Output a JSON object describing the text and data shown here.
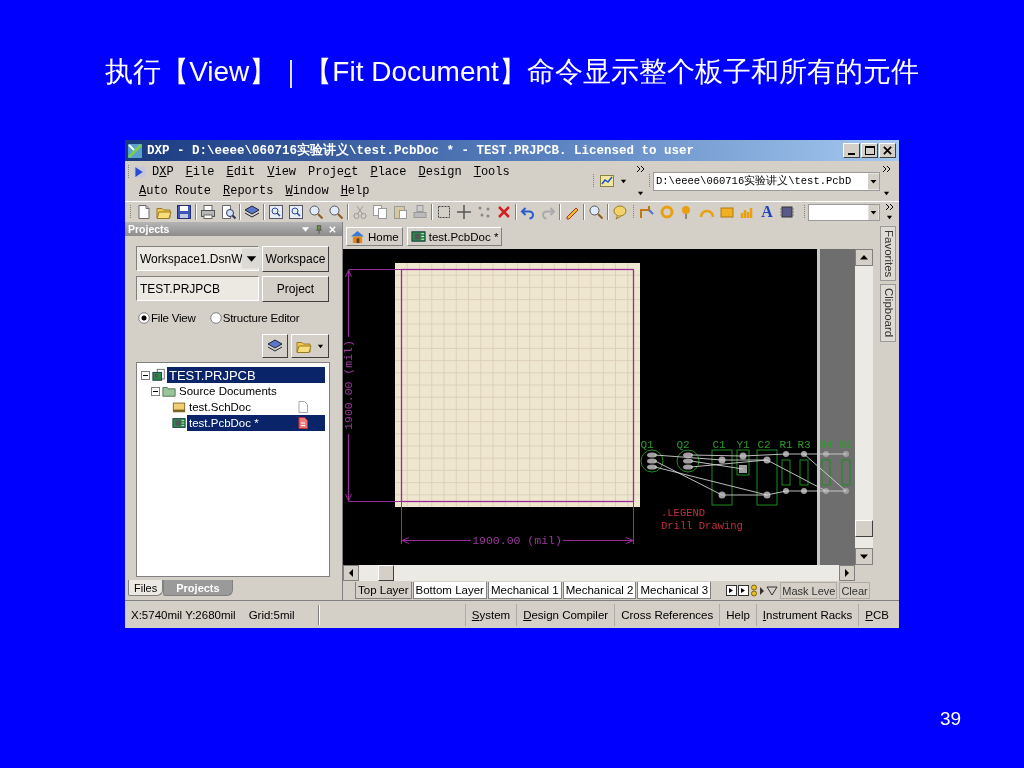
{
  "slide": {
    "title": "执行【View】｜【Fit Document】命令显示整个板子和所有的元件",
    "page_number": "39"
  },
  "window": {
    "title": "DXP - D:\\eeee\\060716实验讲义\\test.PcbDoc * - TEST.PRJPCB. Licensed to user"
  },
  "menu_rows": [
    [
      {
        "text": "D",
        "key": "X",
        "rest": "P"
      },
      {
        "key": "F",
        "rest": "ile"
      },
      {
        "key": "E",
        "rest": "dit"
      },
      {
        "key": "V",
        "rest": "iew"
      },
      {
        "text": "Proje",
        "key": "c",
        "rest": "t"
      },
      {
        "key": "P",
        "rest": "lace"
      },
      {
        "key": "D",
        "rest": "esign"
      },
      {
        "key": "T",
        "rest": "ools"
      }
    ],
    [
      {
        "key": "A",
        "rest": "uto Route"
      },
      {
        "key": "R",
        "rest": "eports"
      },
      {
        "key": "W",
        "rest": "indow"
      },
      {
        "key": "H",
        "rest": "elp"
      }
    ]
  ],
  "path_field": {
    "value": "D:\\eeee\\060716实验讲义\\test.PcbD"
  },
  "toolbar": {
    "text_tool": "A"
  },
  "projects_panel": {
    "title": "Projects",
    "workspace": {
      "value": "Workspace1.DsnW",
      "button": "Workspace"
    },
    "project": {
      "value": "TEST.PRJPCB",
      "button": "Project"
    },
    "views": [
      {
        "label": "File View",
        "selected": true
      },
      {
        "label": "Structure Editor",
        "selected": false
      }
    ],
    "tree": [
      {
        "label": "TEST.PRJPCB",
        "kind": "project",
        "expanded": true,
        "selected": true,
        "children": [
          {
            "label": "Source Documents",
            "kind": "folder",
            "expanded": true,
            "selected": false,
            "children": [
              {
                "label": "test.SchDoc",
                "kind": "schematic",
                "selected": false,
                "modified": false
              },
              {
                "label": "test.PcbDoc *",
                "kind": "pcb",
                "selected": true,
                "modified": true
              }
            ]
          }
        ]
      }
    ],
    "tabs": [
      {
        "label": "Files",
        "selected": false
      },
      {
        "label": "Projects",
        "selected": true
      }
    ]
  },
  "document_tabs": [
    {
      "label": "Home",
      "kind": "home"
    },
    {
      "label": "test.PcbDoc *",
      "kind": "pcb"
    }
  ],
  "pcb": {
    "dimension_labels": [
      "1900.00 (mil)",
      "1900.00 (mil)"
    ],
    "components": [
      {
        "designator": "Q1",
        "kind": "transistor"
      },
      {
        "designator": "Q2",
        "kind": "transistor"
      },
      {
        "designator": "C1",
        "kind": "capacitor"
      },
      {
        "designator": "Y1",
        "kind": "crystal"
      },
      {
        "designator": "C2",
        "kind": "capacitor"
      },
      {
        "designator": "R1",
        "kind": "resistor"
      },
      {
        "designator": "R3",
        "kind": "resistor"
      },
      {
        "designator": "R4",
        "kind": "resistor"
      },
      {
        "designator": "R2",
        "kind": "resistor"
      }
    ],
    "layer_texts": [
      ".LEGEND",
      "Drill Drawing"
    ]
  },
  "layer_bar": {
    "tabs": [
      {
        "label": "Top Layer",
        "selected": true
      },
      {
        "label": "Bottom Layer",
        "selected": false
      },
      {
        "label": "Mechanical 1",
        "selected": false
      },
      {
        "label": "Mechanical 2",
        "selected": false
      },
      {
        "label": "Mechanical 3",
        "selected": false
      }
    ],
    "buttons": [
      "Mask Leve",
      "Clear"
    ]
  },
  "side_tabs": [
    "Favorites",
    "Clipboard"
  ],
  "status_bar": {
    "coordinates": "X:5740mil Y:2680mil",
    "grid": "Grid:5mil",
    "buttons": [
      {
        "key": "S",
        "rest": "ystem"
      },
      {
        "key": "D",
        "rest": "esign Compiler"
      },
      {
        "text": "Cross References"
      },
      {
        "text": "Help"
      },
      {
        "key": "I",
        "rest": "nstrument Racks"
      },
      {
        "key": "P",
        "rest": "CB"
      }
    ]
  }
}
